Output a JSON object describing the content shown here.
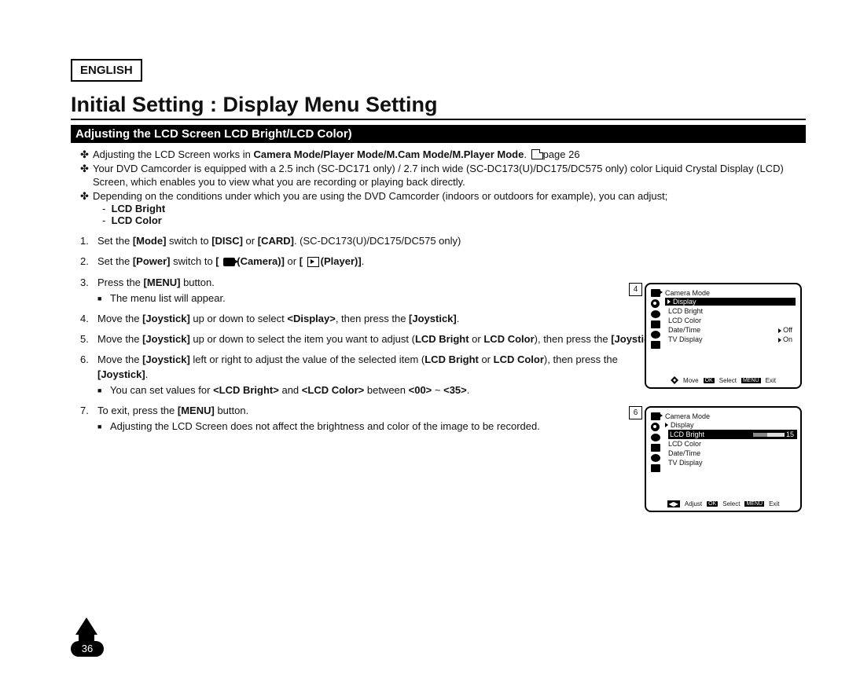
{
  "lang": "ENGLISH",
  "title": "Initial Setting : Display Menu Setting",
  "bar": "Adjusting the LCD Screen LCD Bright/LCD Color)",
  "b1a": "Adjusting the LCD Screen works in ",
  "b1b": "Camera Mode/Player Mode/M.Cam Mode/M.Player Mode",
  "b1c": ". ",
  "b1d": "page 26",
  "b2": "Your DVD Camcorder is equipped with a 2.5 inch (SC-DC171 only) / 2.7 inch wide (SC-DC173(U)/DC175/DC575 only) color Liquid Crystal Display (LCD) Screen, which enables you to view what you are recording or playing back directly.",
  "b3": "Depending on the conditions under which you are using the DVD Camcorder (indoors or outdoors for example), you can adjust;",
  "b3s1": "LCD Bright",
  "b3s2": "LCD Color",
  "s1a": "Set the ",
  "s1b": "[Mode]",
  "s1c": " switch to ",
  "s1d": "[DISC]",
  "s1e": " or ",
  "s1f": "[CARD]",
  "s1g": ". (SC-DC173(U)/DC175/DC575 only)",
  "s2a": "Set the ",
  "s2b": "[Power]",
  "s2c": " switch to ",
  "s2d": "(Camera)]",
  "s2e": " or ",
  "s2f": "(Player)]",
  "s3a": "Press the ",
  "s3b": "[MENU]",
  "s3c": " button.",
  "s3sub": "The menu list will appear.",
  "s4a": "Move the ",
  "s4b": "[Joystick]",
  "s4c": " up or down to select ",
  "s4d": "<Display>",
  "s4e": ", then press the ",
  "s4f": "[Joystick]",
  "s5a": "Move the ",
  "s5b": "[Joystick]",
  "s5c": " up or down to select the item you want to adjust (",
  "s5d": "LCD Bright",
  "s5e": " or ",
  "s5f": "LCD Color",
  "s5g": "), then press the ",
  "s5h": "[Joystick]",
  "s6a": "Move the ",
  "s6b": "[Joystick]",
  "s6c": " left or right to adjust the value of the selected item (",
  "s6d": "LCD Bright",
  "s6e": " or ",
  "s6f": "LCD Color",
  "s6g": "), then press the ",
  "s6h": "[Joystick]",
  "s6sub_a": "You can set values for ",
  "s6sub_b": "<LCD Bright>",
  "s6sub_c": " and ",
  "s6sub_d": "<LCD Color>",
  "s6sub_e": " between ",
  "s6sub_f": "<00>",
  "s6sub_g": " ~ ",
  "s6sub_h": "<35>",
  "s7a": "To exit, press the ",
  "s7b": "[MENU]",
  "s7c": " button.",
  "s7sub": "Adjusting the LCD Screen does not affect the brightness and color of the image to be recorded.",
  "screen": {
    "badge4": "4",
    "badge6": "6",
    "mode": "Camera Mode",
    "section": "Display",
    "i1": "LCD Bright",
    "i2": "LCD Color",
    "i3": "Date/Time",
    "i3v": "Off",
    "i4": "TV Display",
    "i4v": "On",
    "slider_val": "15",
    "move": "Move",
    "adjust": "Adjust",
    "select": "Select",
    "ok": "OK",
    "menu": "MENU",
    "exit": "Exit"
  },
  "page_num": "36"
}
